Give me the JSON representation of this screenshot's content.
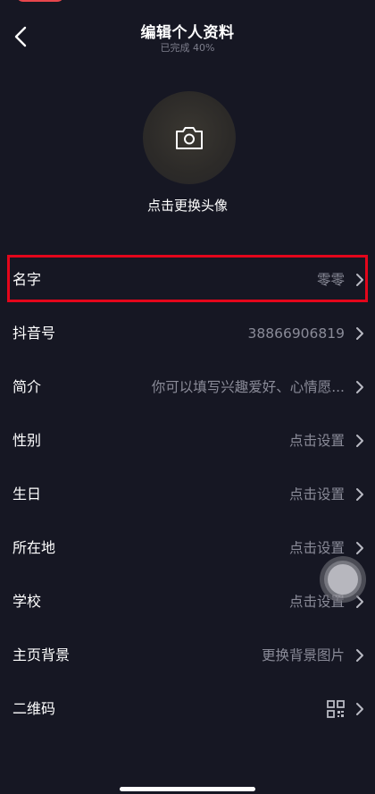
{
  "header": {
    "title": "编辑个人资料",
    "subtitle": "已完成 40%"
  },
  "avatar": {
    "label": "点击更换头像",
    "icon": "camera-icon"
  },
  "rows": [
    {
      "label": "名字",
      "value": "零零"
    },
    {
      "label": "抖音号",
      "value": "38866906819"
    },
    {
      "label": "简介",
      "value": "你可以填写兴趣爱好、心情愿..."
    },
    {
      "label": "性别",
      "value": "点击设置"
    },
    {
      "label": "生日",
      "value": "点击设置"
    },
    {
      "label": "所在地",
      "value": "点击设置"
    },
    {
      "label": "学校",
      "value": "点击设置"
    },
    {
      "label": "主页背景",
      "value": "更换背景图片"
    },
    {
      "label": "二维码",
      "value": ""
    }
  ],
  "colors": {
    "background": "#161723",
    "highlight": "#e3061b",
    "secondary_text": "#8a8b98"
  }
}
